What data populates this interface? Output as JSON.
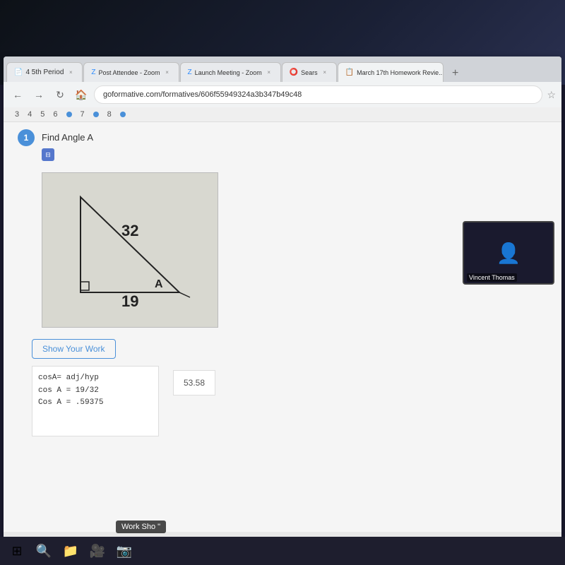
{
  "dark_bg": "#0d1117",
  "browser": {
    "tabs": [
      {
        "label": "4 5th Period",
        "active": false,
        "icon": "📄"
      },
      {
        "label": "Post Attendee - Zoom",
        "active": false,
        "icon": "🎥"
      },
      {
        "label": "Launch Meeting - Zoom",
        "active": false,
        "icon": "🎥"
      },
      {
        "label": "Sears",
        "active": false,
        "icon": "🟠"
      },
      {
        "label": "March 17th Homework Revie...",
        "active": true,
        "icon": "📋"
      }
    ],
    "url": "goformative.com/formatives/606f55949324a3b347b49c48",
    "new_tab_label": "+"
  },
  "pager": {
    "numbers": [
      "3",
      "4",
      "5",
      "6",
      "7",
      "8"
    ],
    "active_dot": true
  },
  "question": {
    "number": "1",
    "text": "Find Angle A",
    "triangle": {
      "hypotenuse": "32",
      "adjacent": "19",
      "angle_label": "A"
    }
  },
  "work_section": {
    "button_label": "Show Your Work",
    "work_lines": [
      "cosA= adj/hyp",
      "cos A = 19/32",
      "Cos A = .59375"
    ],
    "answer_value": "53.58"
  },
  "video": {
    "label": "Vincent Thomas"
  },
  "taskbar": {
    "icons": [
      "⊞",
      "🔍",
      "📁",
      "🎥",
      "📷"
    ],
    "work_sho_label": "Work Sho \""
  }
}
